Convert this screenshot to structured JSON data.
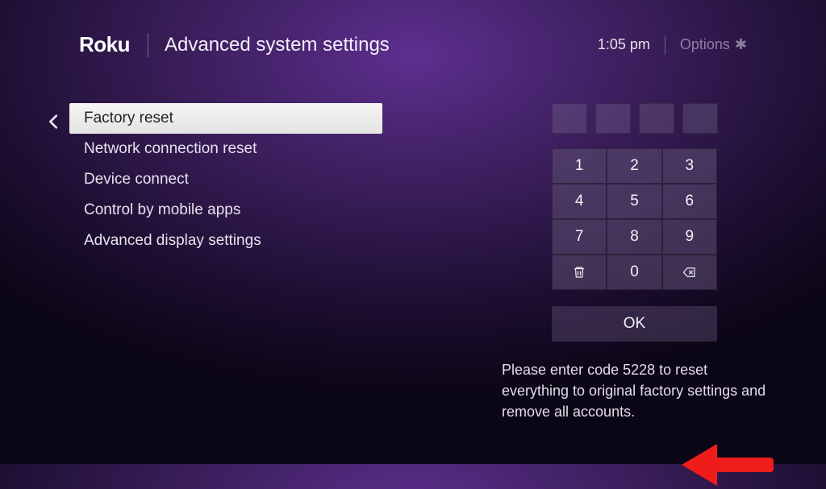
{
  "header": {
    "logo": "Roku",
    "title": "Advanced system settings",
    "clock": "1:05 pm",
    "options_label": "Options",
    "options_glyph": "✱"
  },
  "menu": {
    "items": [
      {
        "label": "Factory reset",
        "selected": true
      },
      {
        "label": "Network connection reset",
        "selected": false
      },
      {
        "label": "Device connect",
        "selected": false
      },
      {
        "label": "Control by mobile apps",
        "selected": false
      },
      {
        "label": "Advanced display settings",
        "selected": false
      }
    ]
  },
  "keypad": {
    "rows": [
      [
        "1",
        "2",
        "3"
      ],
      [
        "4",
        "5",
        "6"
      ],
      [
        "7",
        "8",
        "9"
      ]
    ],
    "zero": "0",
    "ok_label": "OK"
  },
  "instruction": {
    "code": "5228",
    "text": "Please enter code 5228 to reset everything to original factory settings and remove all accounts."
  }
}
